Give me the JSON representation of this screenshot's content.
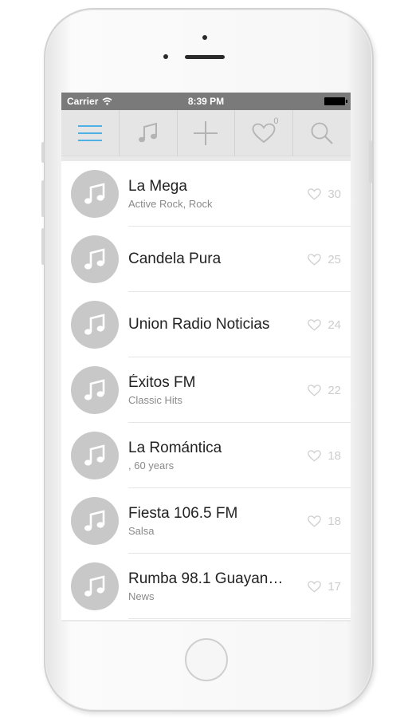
{
  "status_bar": {
    "carrier": "Carrier",
    "time": "8:39 PM"
  },
  "toolbar": {
    "items": [
      {
        "icon": "menu-icon",
        "active": true
      },
      {
        "icon": "music-note-icon"
      },
      {
        "icon": "plus-icon"
      },
      {
        "icon": "heart-icon",
        "badge": "0"
      },
      {
        "icon": "search-icon"
      }
    ],
    "accent_color": "#4fb0e6"
  },
  "stations": [
    {
      "name": "La Mega",
      "genre": "Active Rock, Rock",
      "likes": "30"
    },
    {
      "name": "Candela Pura",
      "genre": "",
      "likes": "25"
    },
    {
      "name": "Union Radio Noticias",
      "genre": "",
      "likes": "24"
    },
    {
      "name": "Éxitos FM",
      "genre": "Classic Hits",
      "likes": "22"
    },
    {
      "name": "La Romántica",
      "genre": ", 60 years",
      "likes": "18"
    },
    {
      "name": "Fiesta 106.5 FM",
      "genre": "Salsa",
      "likes": "18"
    },
    {
      "name": "Rumba 98.1 Guayana...",
      "genre": "News",
      "likes": "17"
    }
  ]
}
